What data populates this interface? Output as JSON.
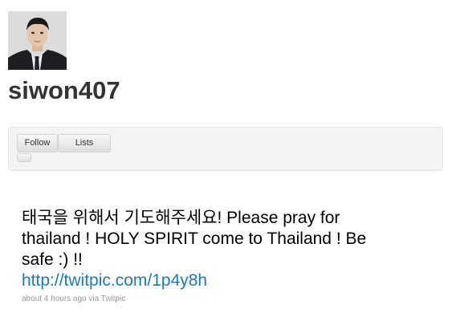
{
  "profile": {
    "username": "siwon407"
  },
  "actions": {
    "follow_label": "Follow",
    "lists_label": "Lists"
  },
  "tweet": {
    "text": "태국을 위해서 기도해주세요! Please pray for thailand ! HOLY SPIRIT come to Thailand ! Be safe :) !!",
    "link": "http://twitpic.com/1p4y8h",
    "meta": "about 4 hours ago via Twitpic"
  },
  "colors": {
    "link": "#1b7bb8",
    "meta": "#999999",
    "username": "#333333"
  }
}
